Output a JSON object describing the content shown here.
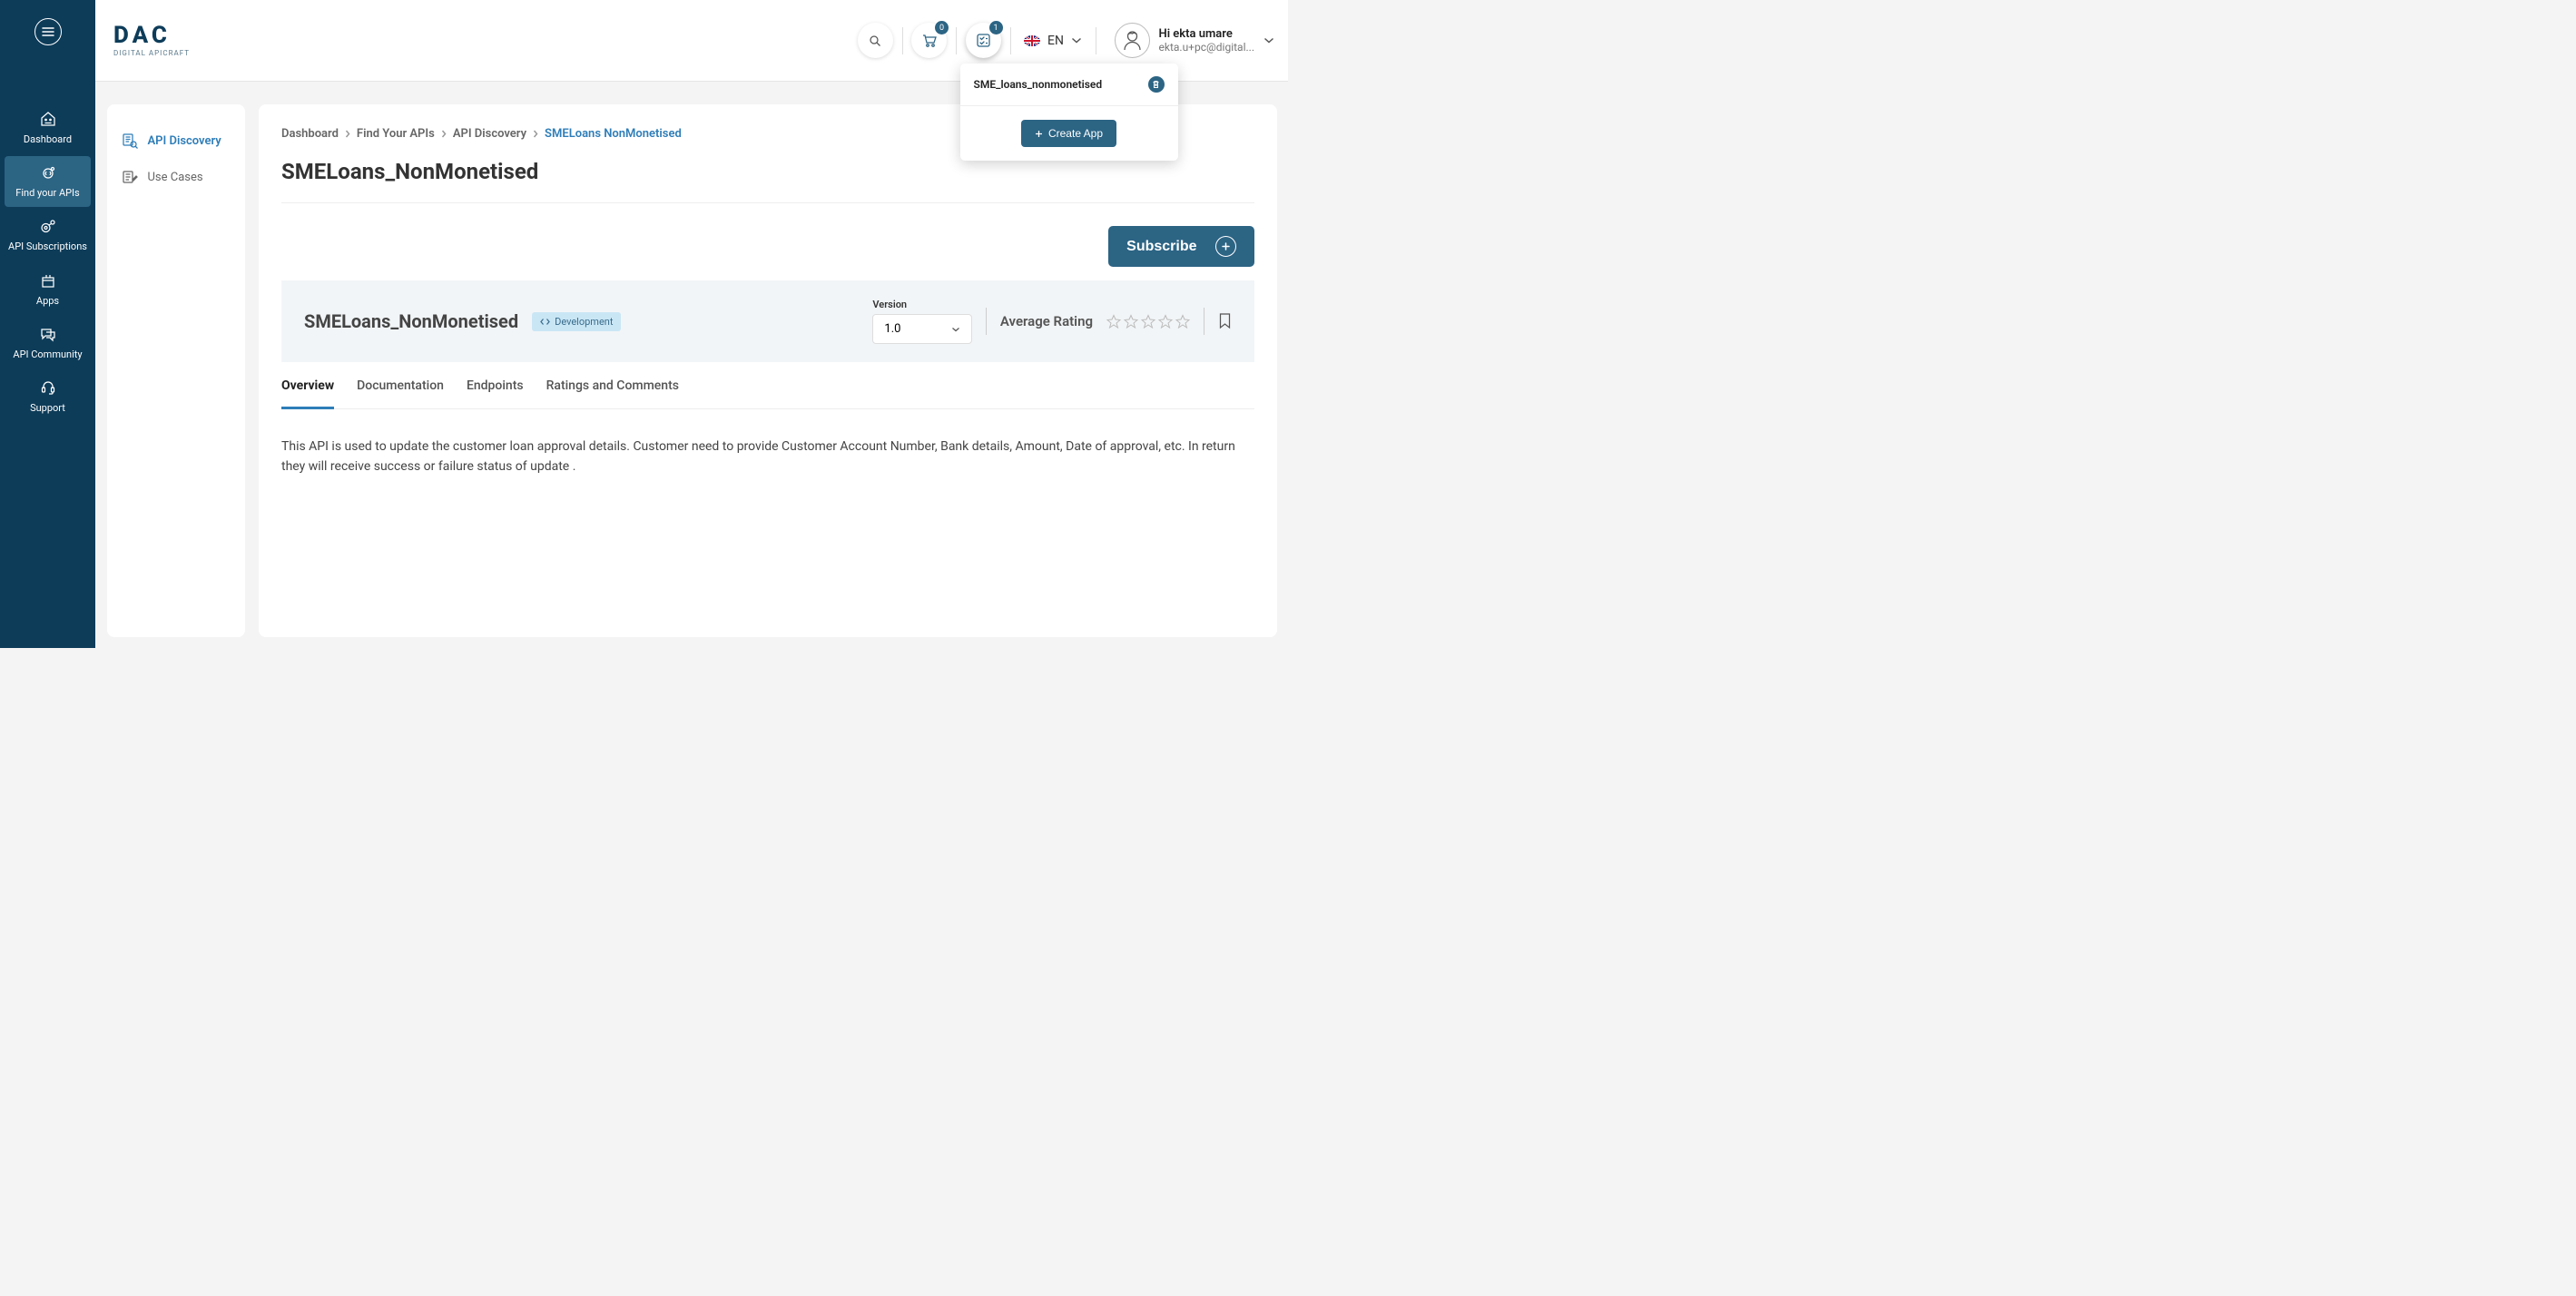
{
  "brand": {
    "name": "DAC",
    "tagline": "DIGITAL APICRAFT"
  },
  "sidebar": {
    "items": [
      {
        "label": "Dashboard"
      },
      {
        "label": "Find your APIs"
      },
      {
        "label": "API Subscriptions"
      },
      {
        "label": "Apps"
      },
      {
        "label": "API Community"
      },
      {
        "label": "Support"
      }
    ]
  },
  "header": {
    "cart_count": "0",
    "notif_count": "1",
    "lang": "EN",
    "user_greeting": "Hi ekta umare",
    "user_email": "ekta.u+pc@digital..."
  },
  "dropdown": {
    "item_label": "SME_loans_nonmonetised",
    "create_label": "Create App"
  },
  "secondary_nav": {
    "items": [
      {
        "label": "API Discovery"
      },
      {
        "label": "Use Cases"
      }
    ]
  },
  "breadcrumb": {
    "items": [
      "Dashboard",
      "Find Your APIs",
      "API Discovery",
      "SMELoans NonMonetised"
    ]
  },
  "page": {
    "title": "SMELoans_NonMonetised",
    "subscribe_label": "Subscribe",
    "api_title": "SMELoans_NonMonetised",
    "badge": "Development",
    "version_label": "Version",
    "version_value": "1.0",
    "rating_label": "Average Rating"
  },
  "tabs": {
    "items": [
      "Overview",
      "Documentation",
      "Endpoints",
      "Ratings and Comments"
    ]
  },
  "overview": {
    "text": "This API is used to update the customer loan approval details. Customer need to provide Customer Account Number, Bank details, Amount, Date of approval, etc. In return they will receive success or failure status of update ."
  }
}
